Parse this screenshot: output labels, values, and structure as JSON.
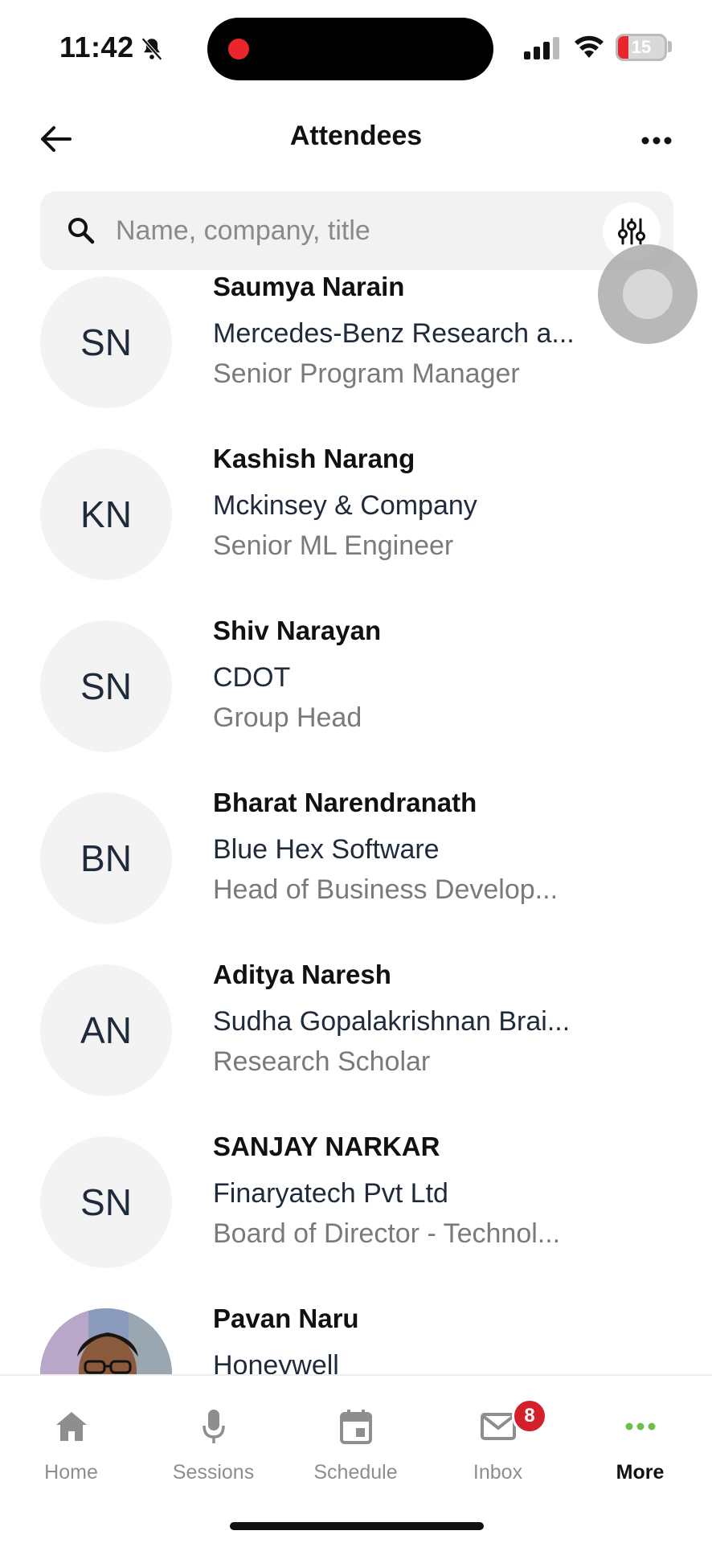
{
  "status_bar": {
    "time": "11:42",
    "battery": "15",
    "battery_color": "#e8262b"
  },
  "header": {
    "title": "Attendees"
  },
  "search": {
    "placeholder": "Name, company, title"
  },
  "attendees": [
    {
      "initials": "SN",
      "name": "Saumya Narain",
      "company": "Mercedes-Benz Research a...",
      "title": "Senior Program Manager"
    },
    {
      "initials": "KN",
      "name": "Kashish Narang",
      "company": "Mckinsey & Company",
      "title": "Senior ML Engineer"
    },
    {
      "initials": "SN",
      "name": "Shiv  Narayan",
      "company": "CDOT",
      "title": "Group Head"
    },
    {
      "initials": "BN",
      "name": "Bharat  Narendranath",
      "company": "Blue Hex Software",
      "title": "Head of Business Develop..."
    },
    {
      "initials": "AN",
      "name": "Aditya Naresh",
      "company": "Sudha Gopalakrishnan Brai...",
      "title": "Research Scholar"
    },
    {
      "initials": "SN",
      "name": "SANJAY NARKAR",
      "company": "Finaryatech Pvt Ltd",
      "title": "Board of Director - Technol..."
    },
    {
      "initials": "",
      "name": "Pavan Naru",
      "company": "Honeywell",
      "title": ""
    }
  ],
  "tabbar": {
    "tabs": [
      {
        "label": "Home",
        "icon": "home-icon"
      },
      {
        "label": "Sessions",
        "icon": "microphone-icon"
      },
      {
        "label": "Schedule",
        "icon": "calendar-icon"
      },
      {
        "label": "Inbox",
        "icon": "mail-icon",
        "badge": "8"
      },
      {
        "label": "More",
        "icon": "more-dots-icon",
        "active": true
      }
    ],
    "accent_color": "#6cc04a",
    "badge_color": "#d3202a"
  }
}
